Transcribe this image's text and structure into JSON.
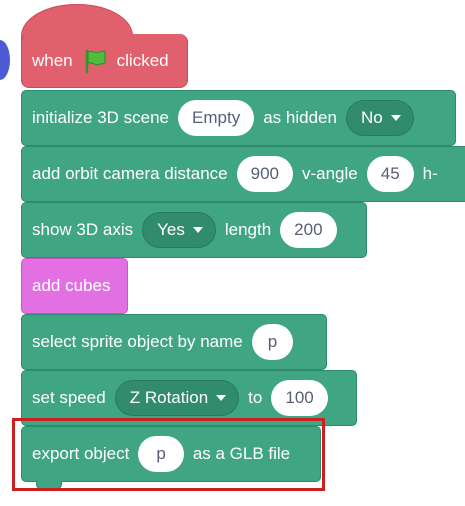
{
  "colors": {
    "hat": "#e0606e",
    "block": "#3fa583",
    "custom_block": "#e370e3",
    "highlight": "#cc1f1f",
    "pill_text": "#575e75"
  },
  "hat_block": {
    "label_when": "when",
    "icon": "green-flag-icon",
    "label_clicked": "clicked"
  },
  "blocks": {
    "init_scene": {
      "label": "initialize 3D scene",
      "scene_value": "Empty",
      "label2": "as hidden",
      "hidden_value": "No"
    },
    "orbit_camera": {
      "label": "add orbit camera distance",
      "distance_value": "900",
      "label2": "v-angle",
      "v_angle_value": "45",
      "label3": "h-"
    },
    "show_axis": {
      "label": "show 3D axis",
      "axis_value": "Yes",
      "label2": "length",
      "length_value": "200"
    },
    "add_cubes": {
      "label": "add cubes"
    },
    "select_sprite": {
      "label": "select sprite object by name",
      "name_value": "p"
    },
    "set_speed": {
      "label": "set speed",
      "property_value": "Z Rotation",
      "label2": "to",
      "speed_value": "100"
    },
    "export_object": {
      "label": "export object",
      "object_value": "p",
      "label2": "as a GLB file"
    }
  }
}
